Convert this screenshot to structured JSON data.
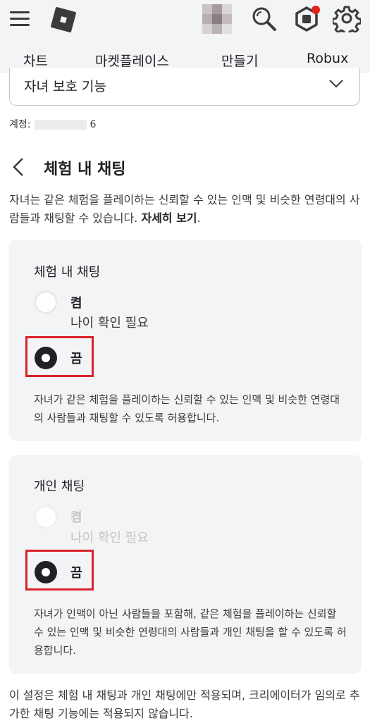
{
  "nav": {
    "items": [
      {
        "label": "차트"
      },
      {
        "label": "마켓플레이스"
      },
      {
        "label": "만들기"
      },
      {
        "label": "Robux"
      }
    ]
  },
  "icons": {
    "menu": "hamburger-menu-icon",
    "logo": "roblox-logo-icon",
    "search": "search-icon",
    "robux": "robux-icon",
    "settings": "gear-icon",
    "notification_color": "#e2231a"
  },
  "dropdown": {
    "label": "자녀 보호 기능"
  },
  "account": {
    "label": "계정:",
    "suffix": "6"
  },
  "page": {
    "title": "체험 내 채팅",
    "description": "자녀는 같은 체험을 플레이하는 신뢰할 수 있는 인맥 및 비슷한 연령대의 사람들과 채팅할 수 있습니다.",
    "learn_more": "자세히 보기",
    "learn_more_suffix": "."
  },
  "cards": [
    {
      "title": "체험 내 채팅",
      "on_label": "켬",
      "on_sublabel": "나이 확인 필요",
      "off_label": "끔",
      "selected": "off",
      "description": "자녀가 같은 체험을 플레이하는 신뢰할 수 있는 인맥 및 비슷한 연령대의 사람들과 채팅할 수 있도록 허용합니다."
    },
    {
      "title": "개인 채팅",
      "on_label": "켬",
      "on_sublabel": "나이 확인 필요",
      "off_label": "끔",
      "selected": "off",
      "on_disabled": true,
      "description": "자녀가 인맥이 아닌 사람들을 포함해, 같은 체험을 플레이하는 신뢰할 수 있는 인맥 및 비슷한 연령대의 사람들과 개인 채팅을 할 수 있도록 허용합니다."
    }
  ],
  "footer": {
    "text": "이 설정은 체험 내 채팅과 개인 채팅에만 적용되며, 크리에이터가 임의로 추가한 채팅 기능에는 적용되지 않습니다."
  },
  "colors": {
    "highlight": "#d8232a",
    "card_bg": "#f2f4f5",
    "topbar_bg": "#f2f4f5"
  }
}
